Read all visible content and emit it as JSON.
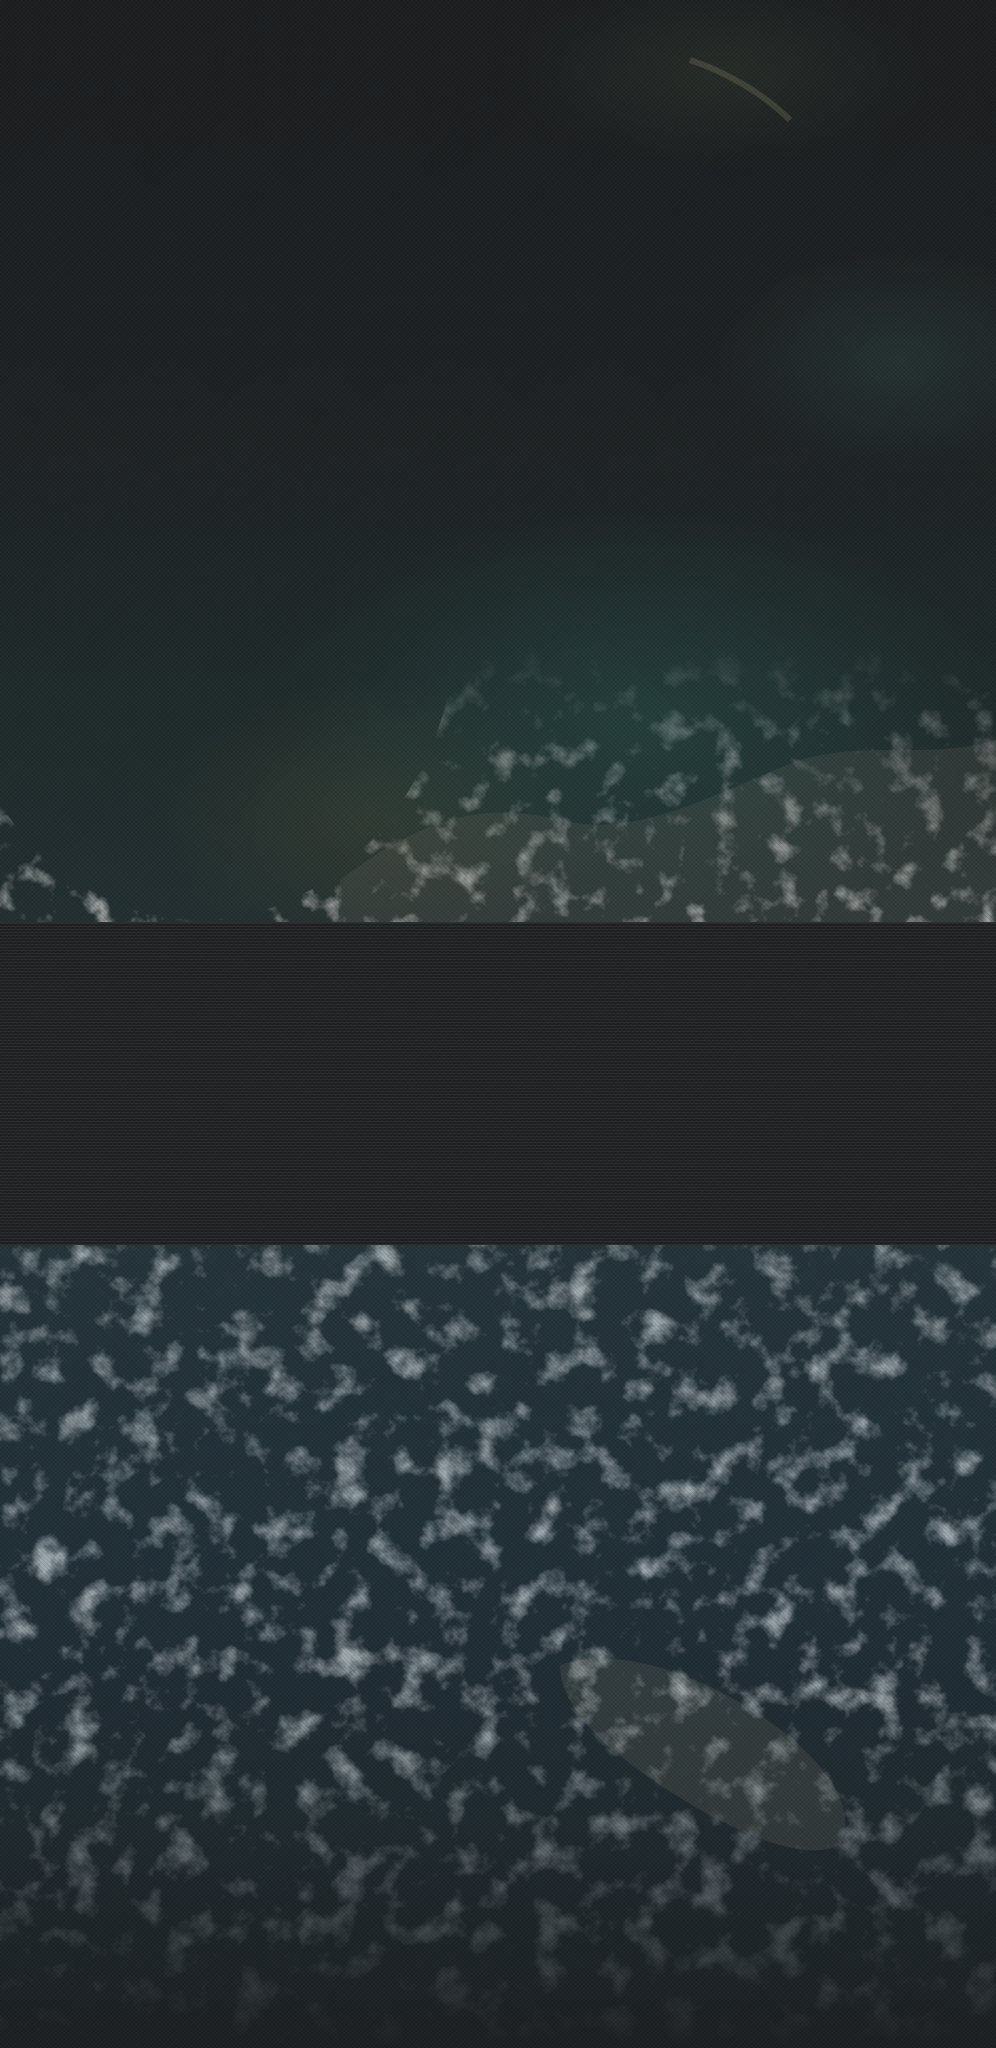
{
  "screen": {
    "wallpaper_top": {
      "description_colors": [
        "#1c1e20",
        "#233031"
      ]
    },
    "mid_band": {
      "color": "#232425"
    },
    "wallpaper_bottom": {
      "description_colors": [
        "#24343a",
        "#1c2022"
      ]
    }
  }
}
